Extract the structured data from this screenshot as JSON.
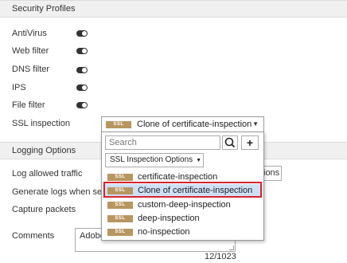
{
  "sections": {
    "security_profiles": "Security Profiles",
    "logging_options": "Logging Options"
  },
  "profiles": [
    {
      "label": "AntiVirus",
      "enabled": false
    },
    {
      "label": "Web filter",
      "enabled": false
    },
    {
      "label": "DNS filter",
      "enabled": false
    },
    {
      "label": "IPS",
      "enabled": false
    },
    {
      "label": "File filter",
      "enabled": false
    }
  ],
  "ssl_inspection": {
    "label": "SSL inspection",
    "badge": "SSL",
    "selected": "Clone of certificate-inspection",
    "search_placeholder": "Search",
    "add_label": "+",
    "options_button": "SSL Inspection Options",
    "options": [
      {
        "label": "certificate-inspection"
      },
      {
        "label": "Clone of certificate-inspection",
        "selected": true
      },
      {
        "label": "custom-deep-inspection"
      },
      {
        "label": "deep-inspection"
      },
      {
        "label": "no-inspection"
      }
    ]
  },
  "logging": {
    "log_allowed_traffic": "Log allowed traffic",
    "log_allowed_traffic_value": "ions",
    "generate_logs": "Generate logs when sessi",
    "capture_packets": "Capture packets"
  },
  "comments": {
    "label": "Comments",
    "value": "Adobe",
    "counter": "12/1023"
  },
  "colors": {
    "ssl_badge": "#b89660",
    "selected_row": "#cfe0f6",
    "highlight": "#d9232e"
  }
}
